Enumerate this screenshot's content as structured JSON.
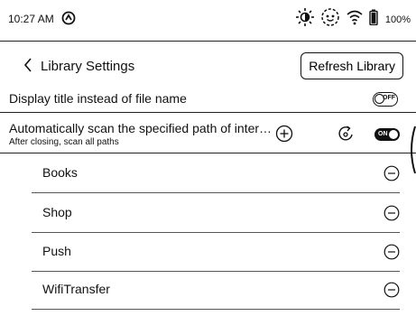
{
  "status": {
    "time": "10:27 AM",
    "battery_pct": "100%",
    "icons": [
      "sync-status-icon",
      "brightness-icon",
      "face-icon",
      "wifi-icon",
      "battery-icon"
    ]
  },
  "header": {
    "title": "Library Settings",
    "refresh_label": "Refresh Library"
  },
  "display_title": {
    "label": "Display title instead of file name",
    "toggle_text": "OFF"
  },
  "auto_scan": {
    "label": "Automatically scan the specified path of internal storage",
    "subtitle": "After closing, scan all paths",
    "toggle_text": "ON"
  },
  "paths": [
    {
      "name": "Books"
    },
    {
      "name": "Shop"
    },
    {
      "name": "Push"
    },
    {
      "name": "WifiTransfer"
    }
  ]
}
